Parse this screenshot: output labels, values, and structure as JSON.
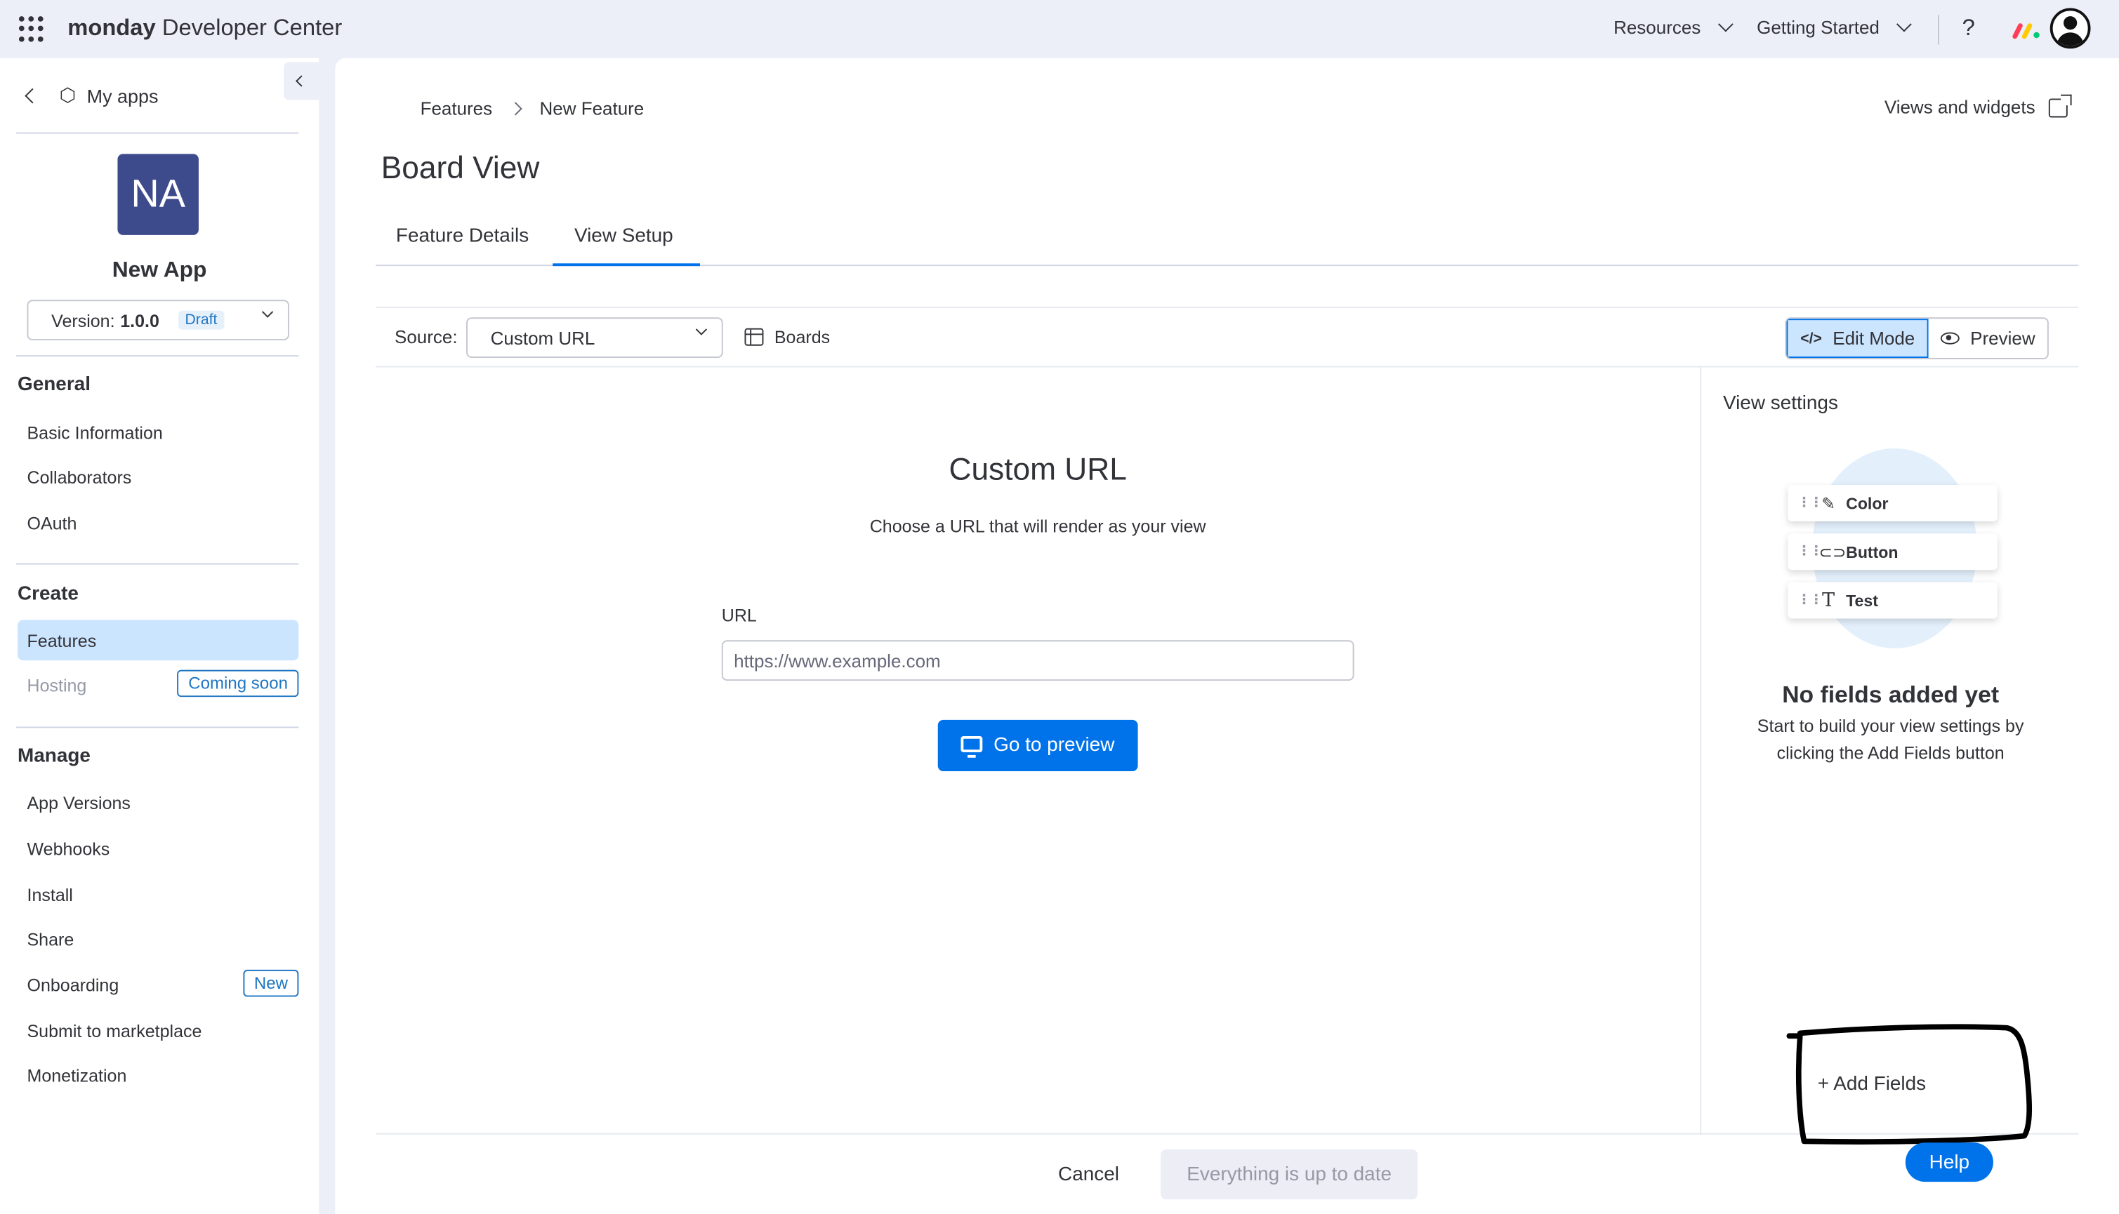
{
  "topbar": {
    "brand_bold": "monday",
    "brand_rest": "Developer Center",
    "resources": "Resources",
    "getting_started": "Getting Started",
    "help_icon": "?"
  },
  "sidebar": {
    "back_label": "My apps",
    "app_initials": "NA",
    "app_name": "New App",
    "version_label": "Version:",
    "version_number": "1.0.0",
    "version_status": "Draft",
    "sections": {
      "general": "General",
      "create": "Create",
      "manage": "Manage"
    },
    "general_items": [
      "Basic Information",
      "Collaborators",
      "OAuth"
    ],
    "create_items": [
      {
        "label": "Features",
        "active": true
      },
      {
        "label": "Hosting",
        "disabled": true,
        "tag": "Coming soon"
      }
    ],
    "manage_items": [
      {
        "label": "App Versions"
      },
      {
        "label": "Webhooks"
      },
      {
        "label": "Install"
      },
      {
        "label": "Share"
      },
      {
        "label": "Onboarding",
        "tag": "New"
      },
      {
        "label": "Submit to marketplace"
      },
      {
        "label": "Monetization"
      }
    ]
  },
  "main": {
    "breadcrumbs": [
      "Features",
      "New Feature"
    ],
    "views_link": "Views and widgets",
    "title": "Board View",
    "tabs": [
      {
        "label": "Feature Details",
        "active": false
      },
      {
        "label": "View Setup",
        "active": true
      }
    ],
    "toolbar": {
      "source_label": "Source:",
      "source_value": "Custom URL",
      "boards_label": "Boards",
      "edit_mode": "Edit Mode",
      "preview": "Preview"
    },
    "custom_url": {
      "title": "Custom URL",
      "subtitle": "Choose a URL that will render as your view",
      "url_label": "URL",
      "url_placeholder": "https://www.example.com",
      "preview_button": "Go to preview"
    },
    "view_settings": {
      "title": "View settings",
      "sample_fields": [
        "Color",
        "Button",
        "Test"
      ],
      "empty_title": "No fields added yet",
      "empty_text": "Start to build your view settings by clicking the Add Fields button",
      "add_fields": "+ Add Fields"
    },
    "footer": {
      "cancel": "Cancel",
      "status_button": "Everything is up to date"
    }
  },
  "help_button": "Help",
  "colors": {
    "primary": "#0073ea",
    "active_bg": "#cce5ff",
    "app_logo": "#3d4a8b",
    "page_bg": "#eceff8"
  }
}
